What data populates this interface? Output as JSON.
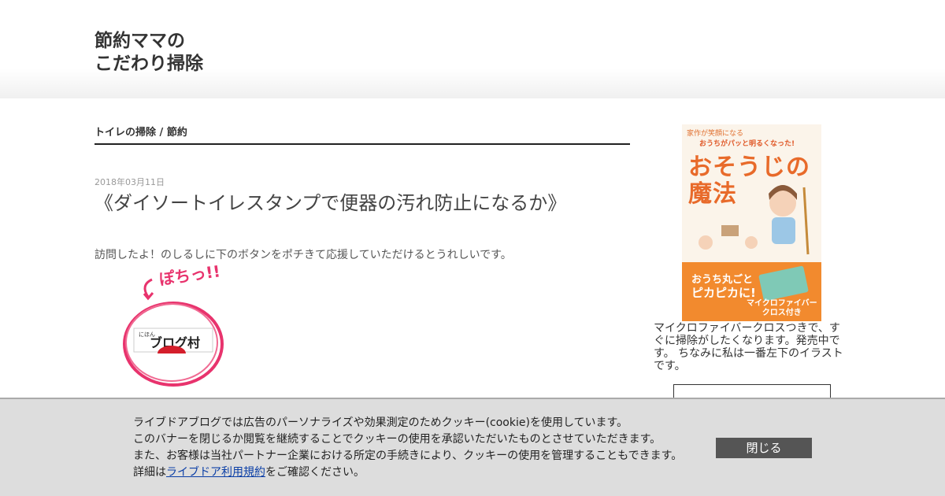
{
  "header": {
    "site_title_line1": "節約ママの",
    "site_title_line2": "こだわり掃除"
  },
  "main": {
    "category_link": "トイレの掃除",
    "category_sep": " / ",
    "category_tag": "節約",
    "post_date": "2018年03月11日",
    "post_title": "《ダイソートイレスタンプで便器の汚れ防止になるか》",
    "intro_text": "訪問したよ！のしるしに下のボタンをポチきて応援していただけるとうれしいです。",
    "banner": {
      "pochi_text": "ぽちっ!!",
      "small_text": "にほん",
      "name": "ブログ村"
    }
  },
  "sidebar": {
    "book": {
      "tagline": "家作が笑顔になる",
      "headline": "おうちがパッと明るくなった!",
      "title_line1": "おそうじの",
      "title_line2": "魔法",
      "bottom_line1": "おうち丸ごと",
      "bottom_line2": "ピカピカに!",
      "bonus_line1": "マイクロファイバー",
      "bonus_line2": "クロス付き"
    },
    "description": "マイクロファイバークロスつきで、すぐに掃除がしたくなります。発売中です。 ちなみに私は一番左下のイラストです。"
  },
  "cookie": {
    "line1": "ライブドアブログでは広告のパーソナライズや効果測定のためクッキー(cookie)を使用しています。",
    "line2": "このバナーを閉じるか閲覧を継続することでクッキーの使用を承認いただいたものとさせていただきます。",
    "line3": "また、お客様は当社パートナー企業における所定の手続きにより、クッキーの使用を管理することもできます。",
    "line4_prefix": "詳細は",
    "link_text": "ライブドア利用規約",
    "line4_suffix": "をご確認ください。",
    "close_label": "閉じる"
  },
  "colors": {
    "accent_orange": "#e86a2a",
    "cookie_bg": "#dddddd",
    "close_button": "#555555",
    "link": "#0a3ea6"
  }
}
